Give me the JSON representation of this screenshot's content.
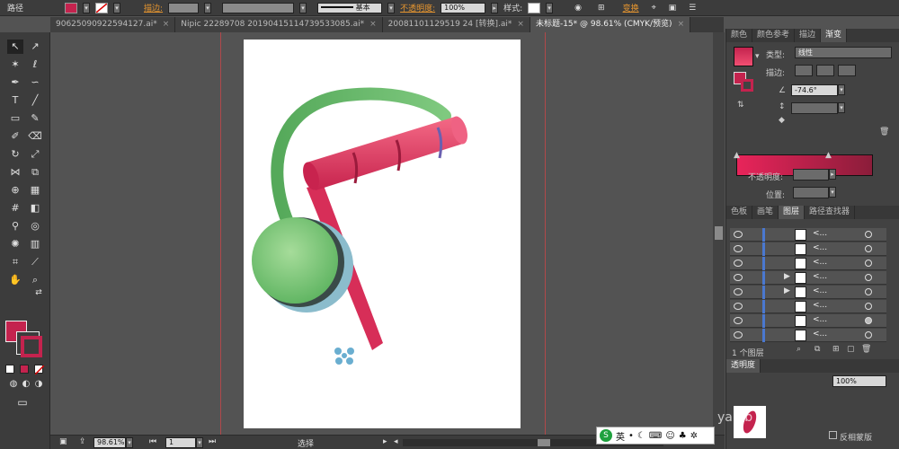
{
  "topbar": {
    "title": "路径",
    "stroke_label": "描边:",
    "stroke_style": "基本",
    "opacity_label": "不透明度:",
    "opacity_value": "100%",
    "style_label": "样式:",
    "transform_label": "变换",
    "accent": "#c4234e"
  },
  "tabs": [
    {
      "label": "90625090922594127.ai*",
      "active": false
    },
    {
      "label": "Nipic 22289708 20190415114739533085.ai*",
      "active": false
    },
    {
      "label": "20081101129519 24 [转换].ai*",
      "active": false
    },
    {
      "label": "未标题-15* @ 98.61% (CMYK/预览)",
      "active": true
    }
  ],
  "tab_close": "×",
  "status": {
    "zoom": "98.61%",
    "page": "1",
    "mode": "选择"
  },
  "gradient_panel": {
    "tabs": [
      "颜色",
      "颜色参考",
      "描边",
      "渐变"
    ],
    "type_label": "类型:",
    "type_value": "线性",
    "stroke_label": "描边:",
    "angle": "-74.6°",
    "opacity_label": "不透明度:",
    "position_label": "位置:",
    "start_color": "#e8245a",
    "end_color": "#8b1d3a"
  },
  "layers_panel": {
    "tabs": [
      "色板",
      "画笔",
      "图层",
      "路径查找器"
    ],
    "rows": [
      "<...",
      "<...",
      "<...",
      "<...",
      "<...",
      "<...",
      "<...",
      "<..."
    ],
    "count": "1 个图层",
    "zoom_field": "100%"
  },
  "transparency_tab": "透明度",
  "bottom_right": {
    "check_label": "反相蒙版",
    "watermark": "yan.b"
  },
  "ime": {
    "label": "英"
  }
}
